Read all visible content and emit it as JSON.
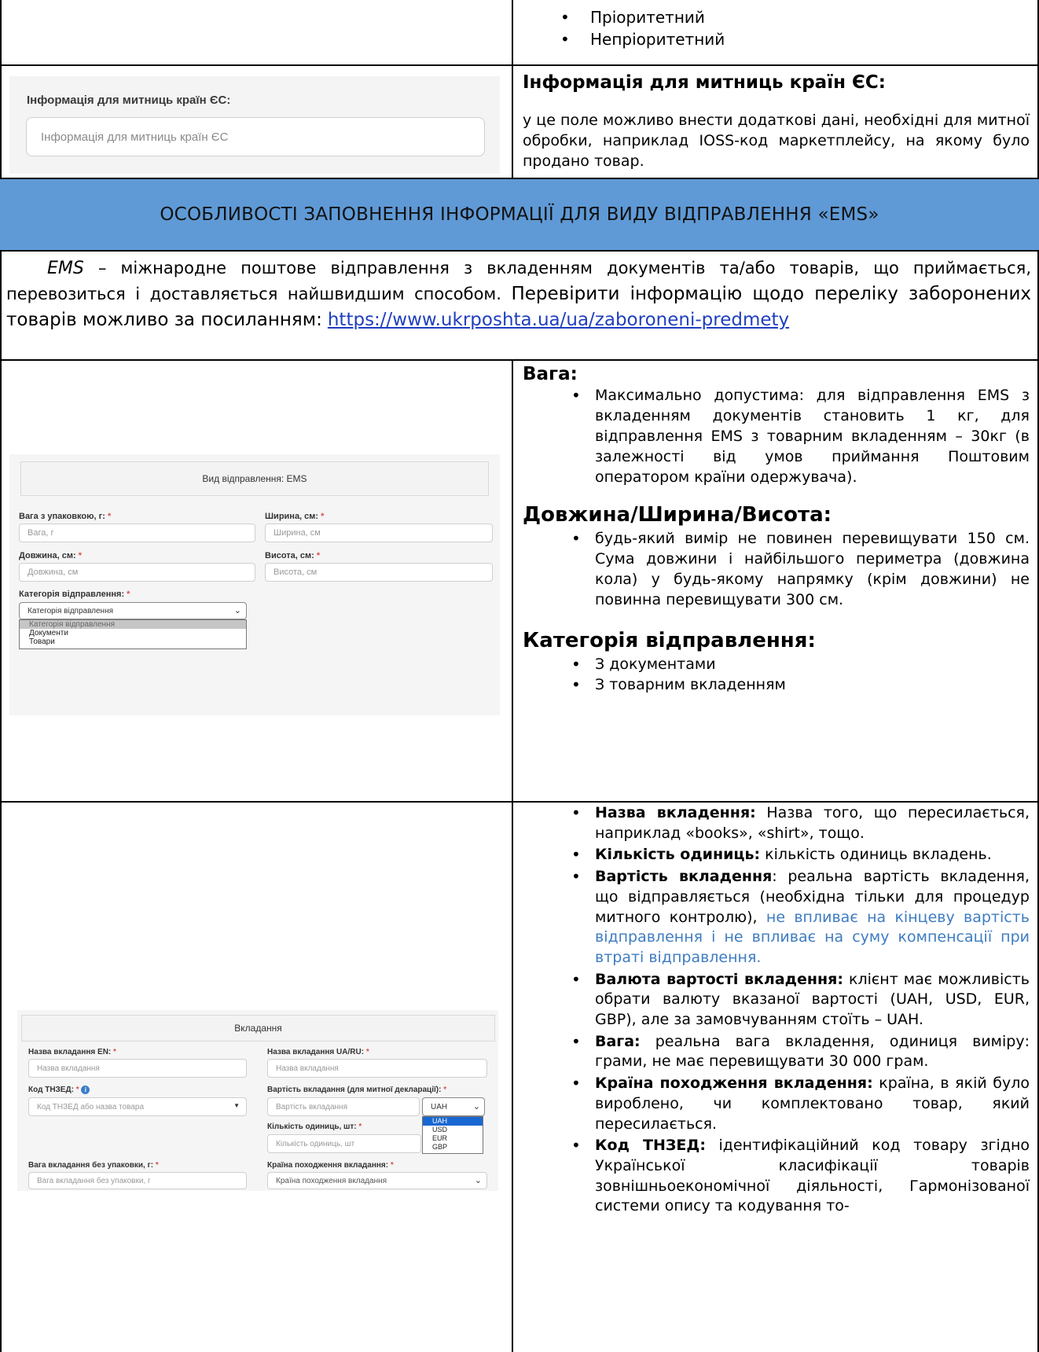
{
  "top_row": {
    "bullets": [
      "Пріоритетний",
      "Непріоритетний"
    ]
  },
  "customs_row": {
    "screenshot": {
      "label": "Інформація для митниць країн ЄС:",
      "placeholder": "Інформація для митниць країн ЄС"
    },
    "heading": "Інформація для митниць країн ЄС:",
    "text": "у це поле можливо внести додаткові дані, необхідні для митної обробки, наприклад IOSS-код маркетплейсу, на якому було продано товар."
  },
  "section_header": "ОСОБЛИВОСТІ ЗАПОВНЕННЯ ІНФОРМАЦІЇ ДЛЯ ВИДУ ВІДПРАВЛЕННЯ «EMS»",
  "intro": {
    "ems_word": "EMS",
    "text_part1": " – міжнародне поштове відправлення з вкладенням документів та/або товарів, що приймається, перевозиться і доставляється найшвидшим способом. ",
    "text_part2": "Перевірити інформацію щодо переліку заборонених товарів можливо за посиланням:",
    "link": "https://www.ukrposhta.ua/ua/zaboroneni-predmety"
  },
  "ems_row": {
    "screenshot": {
      "title": "Вид відправлення: EMS",
      "weight_label": "Вага з упаковкою, г:",
      "weight_placeholder": "Вага, г",
      "width_label": "Ширина, см:",
      "width_placeholder": "Ширина, см",
      "length_label": "Довжина, см:",
      "length_placeholder": "Довжина, см",
      "height_label": "Висота, см:",
      "height_placeholder": "Висота, см",
      "category_label": "Категорія відправлення:",
      "category_value": "Категорія відправлення",
      "category_options": [
        "Категорія відправлення",
        "Документи",
        "Товари"
      ],
      "required_mark": "*"
    },
    "weight_heading": "Вага:",
    "weight_text": "Максимально допустима: для відправлення EMS з вкладенням документів становить 1 кг, для відправлення EMS з товарним вкладенням – 30кг (в залежності від умов приймання Поштовим оператором країни одержувача).",
    "dims_heading": "Довжина/Ширина/Висота:",
    "dims_text": "будь-який вимір не повинен перевищувати 150 см. Сума довжини і найбільшого периметра (довжина кола) у будь-якому напрямку (крім довжини) не повинна перевищувати 300 см.",
    "category_heading": "Категорія відправлення:",
    "category_items": [
      "З документами",
      "З товарним вкладенням"
    ]
  },
  "contents_row": {
    "screenshot": {
      "title": "Вкладання",
      "name_en_label": "Назва вкладання EN:",
      "name_en_placeholder": "Назва вкладання",
      "name_ua_label": "Назва вкладання UA/RU:",
      "name_ua_placeholder": "Назва вкладання",
      "hs_label": "Код ТНЗЕД:",
      "hs_placeholder": "Код ТНЗЕД або назва товара",
      "value_label": "Вартість вкладання (для митної декларації):",
      "value_placeholder": "Вартість вкладання",
      "currency_value": "UAH",
      "currency_options": [
        "UAH",
        "USD",
        "EUR",
        "GBP"
      ],
      "qty_label": "Кількість одиниць, шт:",
      "qty_placeholder": "Кількість одиниць, шт",
      "net_weight_label": "Вага вкладання без упаковки, г:",
      "net_weight_placeholder": "Вага вкладання без упаковки, г",
      "origin_label": "Країна походження вкладання:",
      "origin_placeholder": "Країна походження вкладання",
      "required_mark": "*"
    },
    "items": [
      {
        "bold": "Назва вкладення:",
        "text": " Назва того, що пересилається, наприклад «books», «shirt», тощо."
      },
      {
        "bold": "Кількість одиниць:",
        "text": " кількість одиниць вкладень."
      },
      {
        "bold": "Вартість вкладення",
        "text": ": реальна вартість вкладення, що відправляється (необхідна тільки для процедур митного контролю), ",
        "blue": "не впливає на кінцеву вартість відправлення і не впливає на суму компенсації при втраті відправлення."
      },
      {
        "bold": "Валюта вартості вкладення:",
        "text": " клієнт має можливість обрати валюту вказаної вартості (UAH, USD, EUR, GBP), але за замовчуванням стоїть – UAH."
      },
      {
        "bold": "Вага:",
        "text": " реальна вага вкладення, одиниця виміру: грами, не має перевищувати 30 000 грам."
      },
      {
        "bold": "Країна походження вкладення:",
        "text": " країна, в якій було вироблено, чи комплектовано товар, який пересилається."
      },
      {
        "bold": "Код ТНЗЕД:",
        "text": " ідентифікаційний код товару згідно Української класифікації товарів зовнішньоекономічної діяльності, Гармонізованої системи опису та кодування то-"
      }
    ]
  }
}
